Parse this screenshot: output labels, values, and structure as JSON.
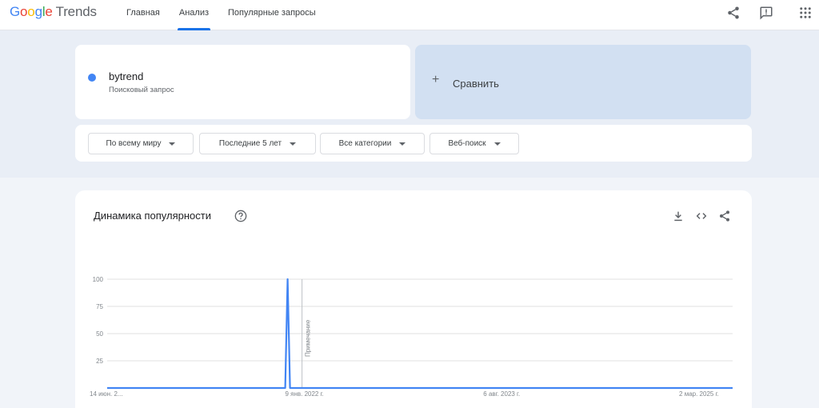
{
  "header": {
    "logo_google": "Google",
    "logo_trends": "Trends",
    "nav": [
      "Главная",
      "Анализ",
      "Популярные запросы"
    ],
    "active_tab": "Анализ",
    "icons": [
      "share-icon",
      "feedback-icon",
      "apps-grid-icon"
    ]
  },
  "search": {
    "term": "bytrend",
    "term_type": "Поисковый запрос",
    "term_color": "#4285f4",
    "compare_label": "Сравнить",
    "compare_icon": "plus-icon"
  },
  "filters": {
    "region": "По всему миру",
    "period": "Последние 5 лет",
    "category": "Все категории",
    "search_type": "Веб-поиск"
  },
  "interest_card": {
    "title": "Динамика популярности",
    "icons": [
      "help-icon",
      "download-icon",
      "embed-icon",
      "share-icon"
    ]
  },
  "chart_data": {
    "type": "line",
    "title": "",
    "xlabel": "",
    "ylabel": "",
    "ylim": [
      0,
      100
    ],
    "yticks": [
      100,
      75,
      50,
      25
    ],
    "grid": true,
    "x_start": "2020-06-14",
    "x_end": "2025-06-08",
    "x_tick_labels": [
      {
        "date": "2020-06-14",
        "label": "14 июн. 2..."
      },
      {
        "date": "2022-01-09",
        "label": "9 янв. 2022 г."
      },
      {
        "date": "2023-08-06",
        "label": "6 авг. 2023 г."
      },
      {
        "date": "2025-03-02",
        "label": "2 мар. 2025 г."
      }
    ],
    "note": {
      "date": "2022-01-02",
      "label": "Примечание"
    },
    "series": [
      {
        "name": "bytrend",
        "color": "#4285f4",
        "points": [
          {
            "x": "2020-06-14",
            "y": 0
          },
          {
            "x": "2021-11-14",
            "y": 0
          },
          {
            "x": "2021-11-21",
            "y": 100
          },
          {
            "x": "2021-11-28",
            "y": 0
          },
          {
            "x": "2025-06-08",
            "y": 0
          }
        ]
      }
    ]
  }
}
